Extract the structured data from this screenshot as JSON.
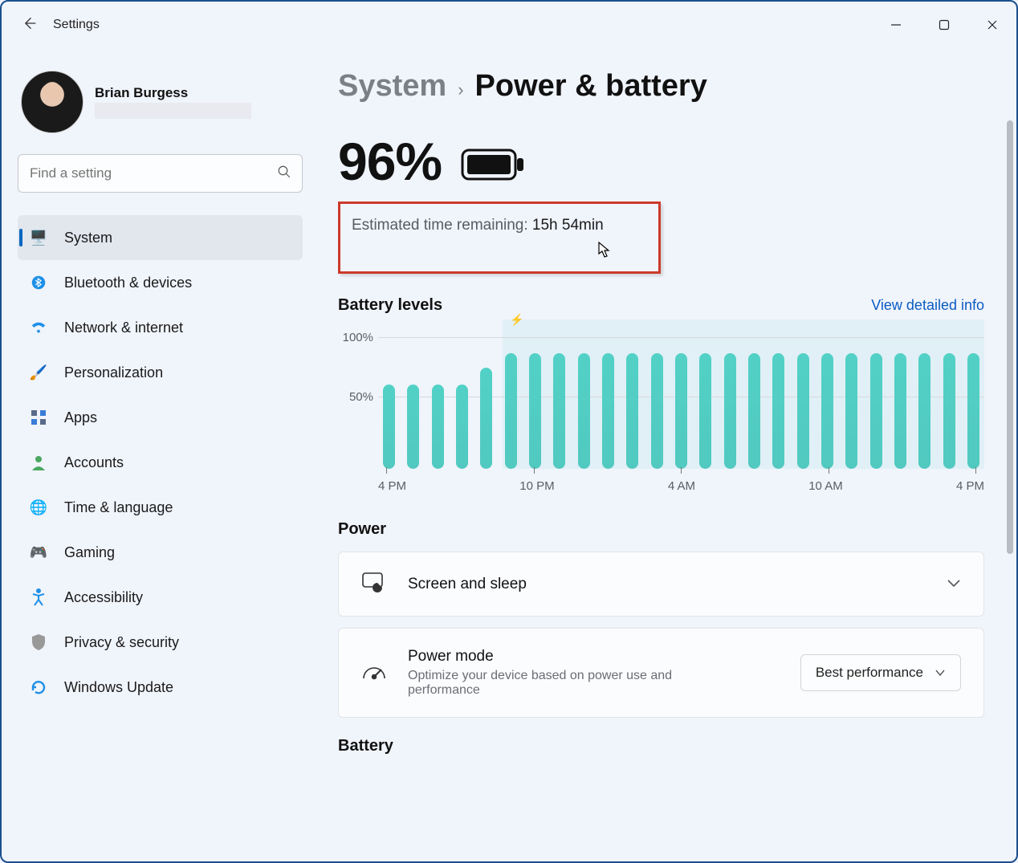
{
  "app_title": "Settings",
  "user": {
    "name": "Brian Burgess"
  },
  "search": {
    "placeholder": "Find a setting"
  },
  "nav": {
    "items": [
      {
        "label": "System"
      },
      {
        "label": "Bluetooth & devices"
      },
      {
        "label": "Network & internet"
      },
      {
        "label": "Personalization"
      },
      {
        "label": "Apps"
      },
      {
        "label": "Accounts"
      },
      {
        "label": "Time & language"
      },
      {
        "label": "Gaming"
      },
      {
        "label": "Accessibility"
      },
      {
        "label": "Privacy & security"
      },
      {
        "label": "Windows Update"
      }
    ]
  },
  "breadcrumb": {
    "parent": "System",
    "current": "Power & battery"
  },
  "battery": {
    "percent": "96%",
    "estimated_label": "Estimated time remaining: ",
    "estimated_value": "15h 54min"
  },
  "levels": {
    "title": "Battery levels",
    "link": "View detailed info"
  },
  "power_section": {
    "title": "Power",
    "screen_sleep": "Screen and sleep",
    "power_mode_title": "Power mode",
    "power_mode_sub": "Optimize your device based on power use and performance",
    "power_mode_value": "Best performance"
  },
  "battery_section": {
    "title": "Battery"
  },
  "chart_data": {
    "type": "bar",
    "title": "Battery levels",
    "xlabel": "",
    "ylabel": "",
    "ylim": [
      0,
      100
    ],
    "ytick_labels": [
      "100%",
      "50%"
    ],
    "xtick_labels": [
      "4 PM",
      "10 PM",
      "4 AM",
      "10 AM",
      "4 PM"
    ],
    "categories": [
      "4 PM",
      "5 PM",
      "6 PM",
      "7 PM",
      "8 PM",
      "9 PM",
      "10 PM",
      "11 PM",
      "12 AM",
      "1 AM",
      "2 AM",
      "3 AM",
      "4 AM",
      "5 AM",
      "6 AM",
      "7 AM",
      "8 AM",
      "9 AM",
      "10 AM",
      "11 AM",
      "12 PM",
      "1 PM",
      "2 PM",
      "3 PM",
      "4 PM"
    ],
    "values": [
      70,
      70,
      70,
      70,
      84,
      96,
      96,
      96,
      96,
      96,
      96,
      96,
      96,
      96,
      96,
      96,
      96,
      96,
      96,
      96,
      96,
      96,
      96,
      96,
      96
    ],
    "plugged_in_start_index": 4
  }
}
